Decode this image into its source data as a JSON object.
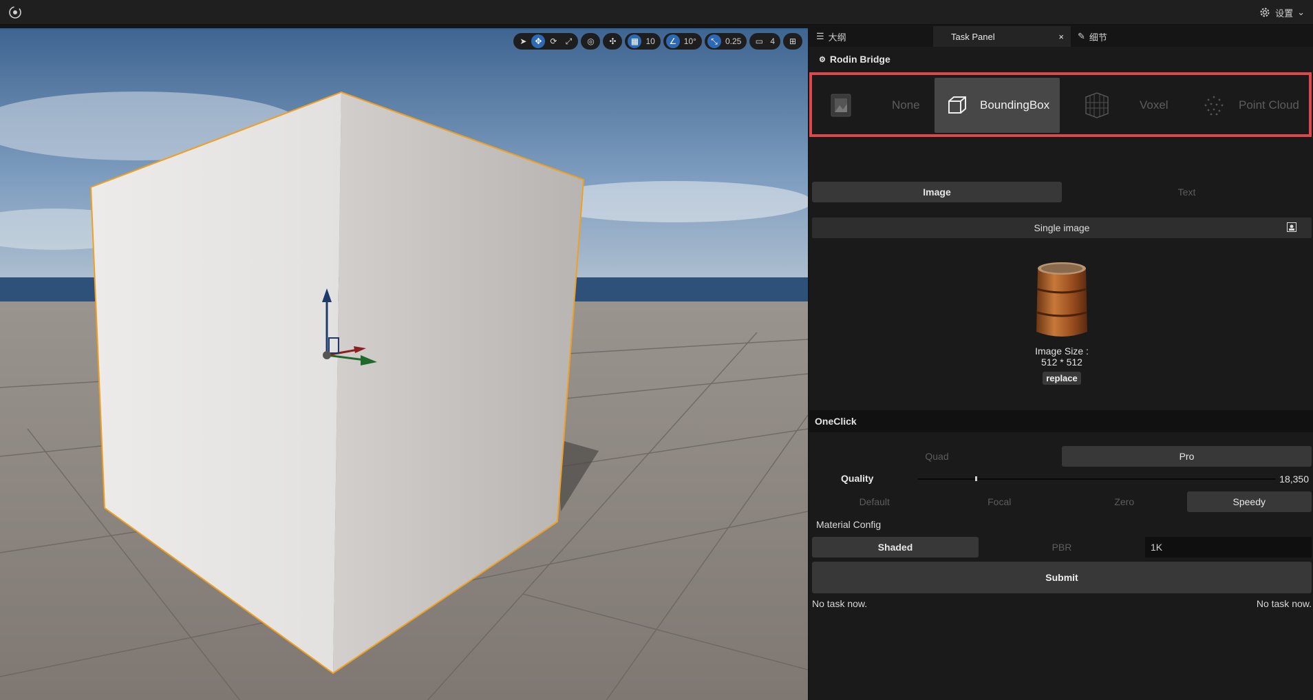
{
  "topbar": {
    "settings_label": "设置"
  },
  "viewport_toolbar": {
    "grid_value": "10",
    "angle_value": "10°",
    "scale_value": "0.25",
    "camera_value": "4"
  },
  "panel": {
    "tabs": [
      {
        "label": "大纲"
      },
      {
        "label": "Task Panel"
      },
      {
        "label": "细节"
      }
    ],
    "title": "Rodin Bridge",
    "modes": [
      {
        "label": "None",
        "selected": false
      },
      {
        "label": "BoundingBox",
        "selected": true
      },
      {
        "label": "Voxel",
        "selected": false
      },
      {
        "label": "Point Cloud",
        "selected": false
      }
    ],
    "input_toggle": {
      "image": "Image",
      "text": "Text",
      "selected": "Image"
    },
    "single_image_label": "Single image",
    "image_size_label": "Image Size :",
    "image_size_value": "512 * 512",
    "replace_label": "replace",
    "oneclick_label": "OneClick",
    "tier": {
      "quad": "Quad",
      "pro": "Pro",
      "selected": "Pro"
    },
    "quality_label": "Quality",
    "quality_value": "18,350",
    "quality_fraction": 0.16,
    "preset": {
      "options": [
        "Default",
        "Focal",
        "Zero",
        "Speedy"
      ],
      "selected": "Speedy"
    },
    "material_config_label": "Material Config",
    "material": {
      "shaded": "Shaded",
      "pbr": "PBR",
      "selected": "Shaded"
    },
    "resolution_value": "1K",
    "submit_label": "Submit",
    "status_left": "No task now.",
    "status_right": "No task now."
  },
  "colors": {
    "accent": "#2d6ab3",
    "highlight_border": "#e0474c",
    "selection_outline": "#f0a020"
  }
}
